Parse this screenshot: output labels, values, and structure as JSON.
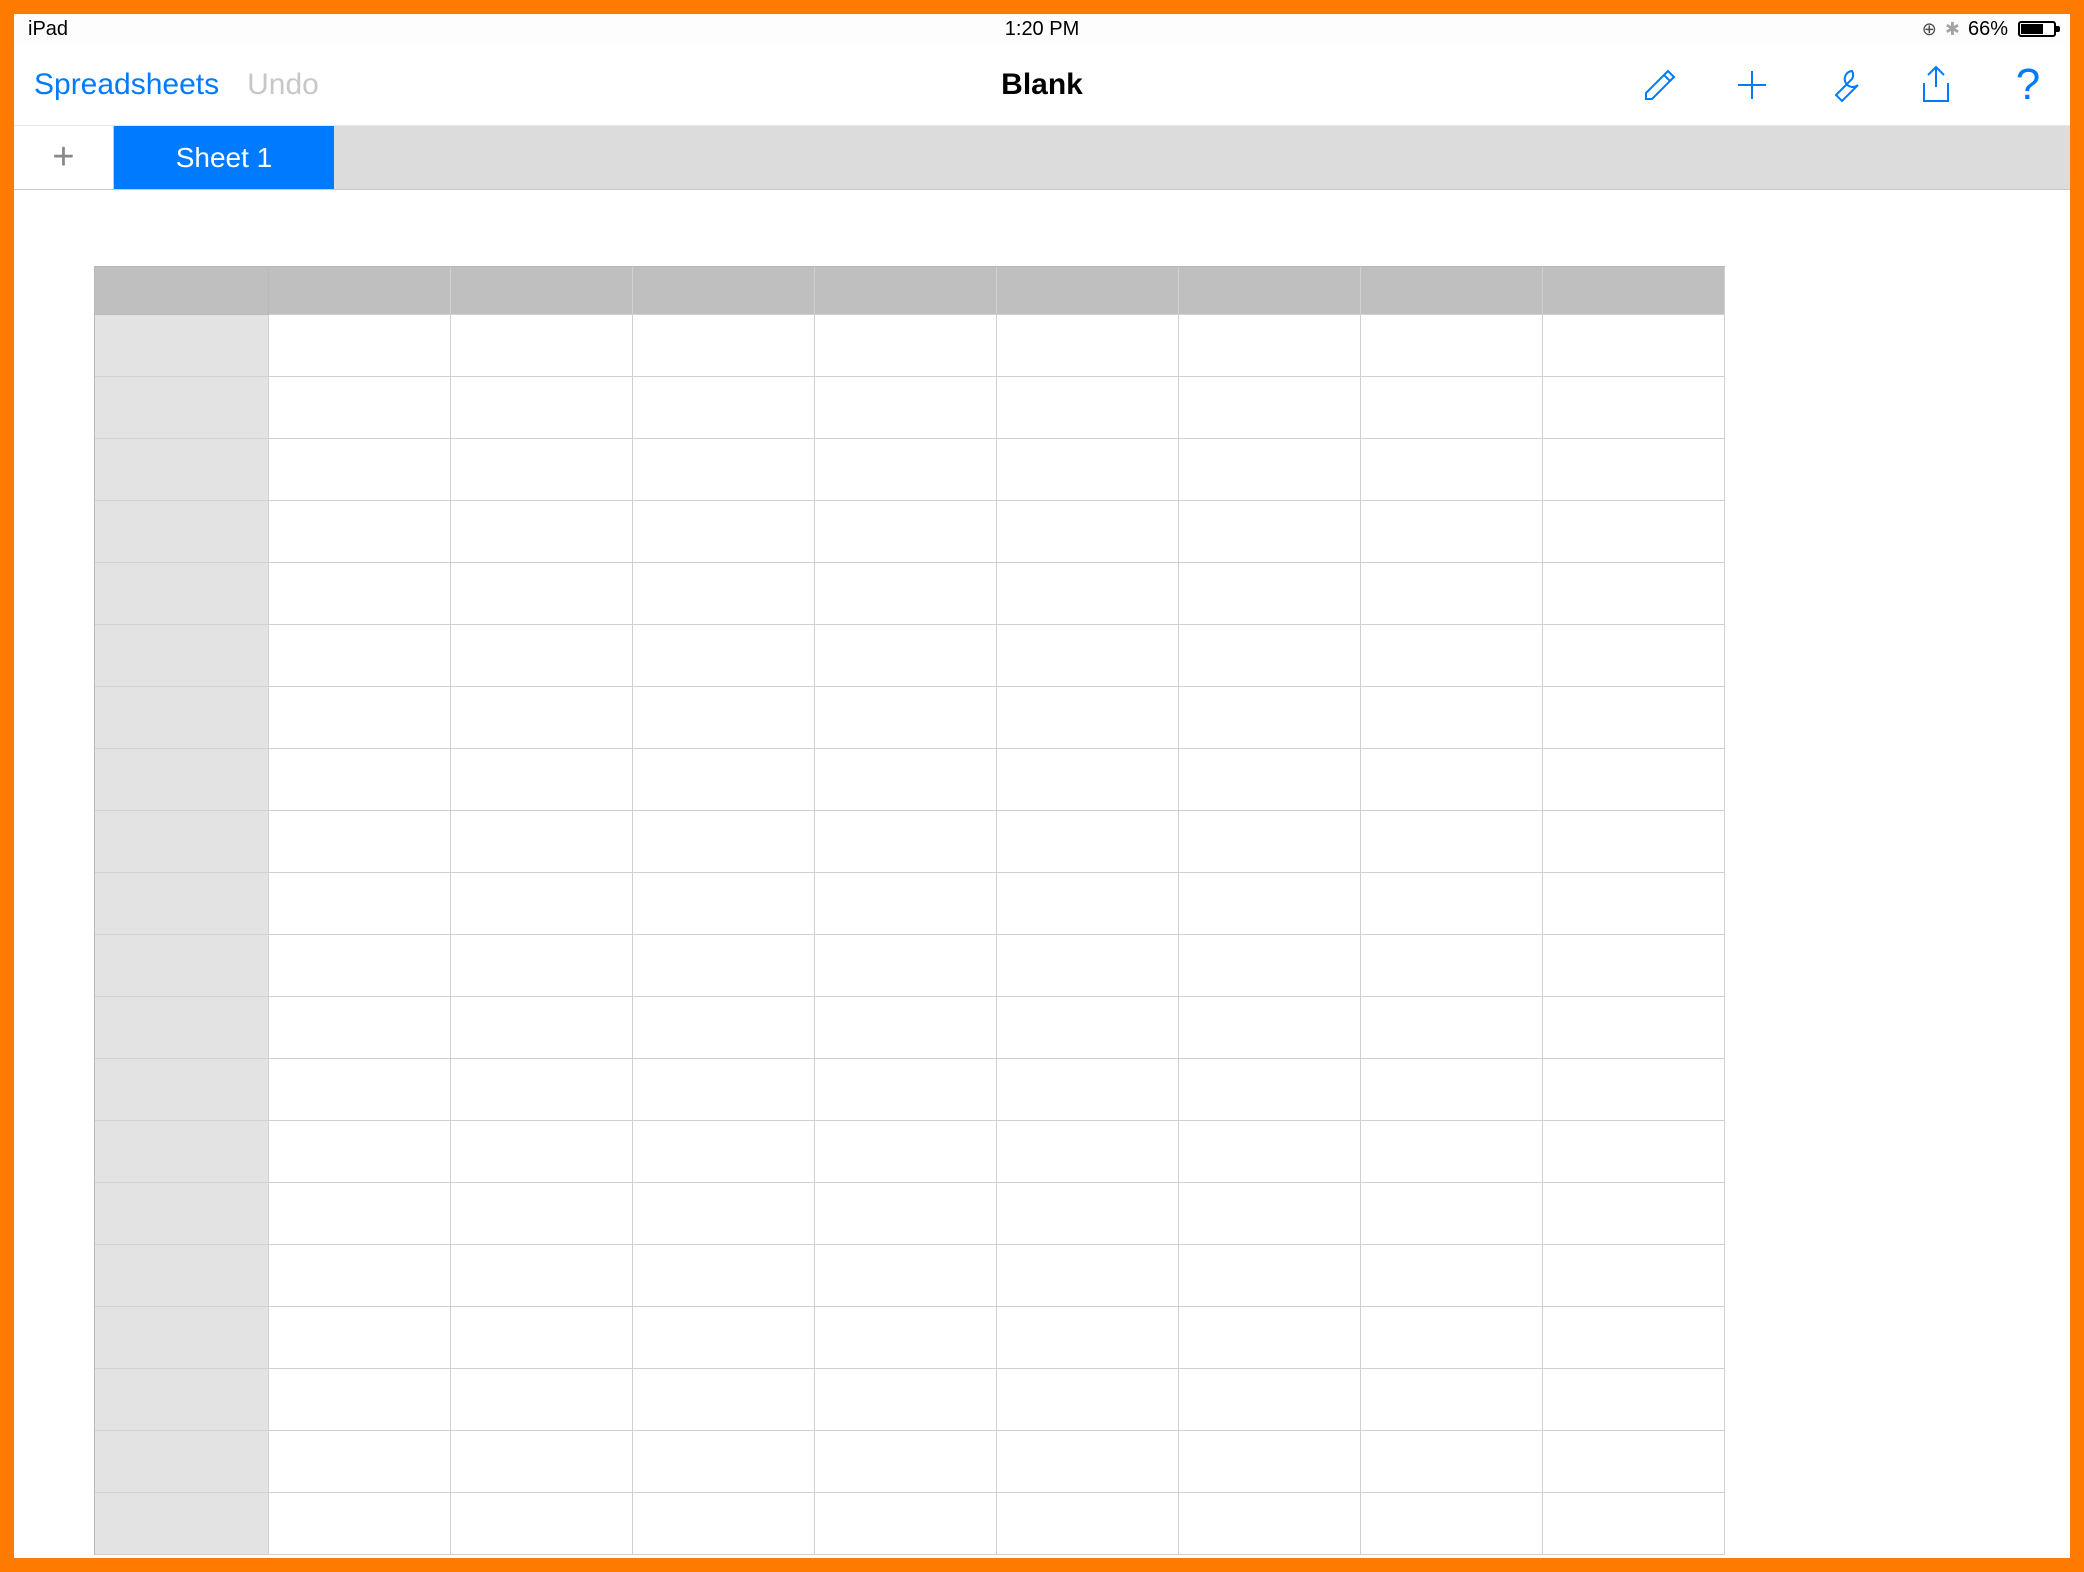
{
  "status_bar": {
    "device": "iPad",
    "time": "1:20 PM",
    "battery_percent": "66%"
  },
  "toolbar": {
    "back_label": "Spreadsheets",
    "undo_label": "Undo",
    "document_title": "Blank",
    "icons": {
      "format": "format-brush-icon",
      "insert": "add-icon",
      "tools": "wrench-icon",
      "share": "share-icon",
      "help": "help-icon",
      "help_glyph": "?"
    }
  },
  "tabs": {
    "add_glyph": "+",
    "items": [
      {
        "label": "Sheet 1",
        "active": true
      }
    ]
  },
  "grid": {
    "columns": 8,
    "rows": 20
  },
  "colors": {
    "accent": "#007aff",
    "frame": "#ff7a00",
    "tab_strip": "#dcdcdc",
    "col_header": "#bfbfbf",
    "row_header": "#e3e3e3"
  }
}
